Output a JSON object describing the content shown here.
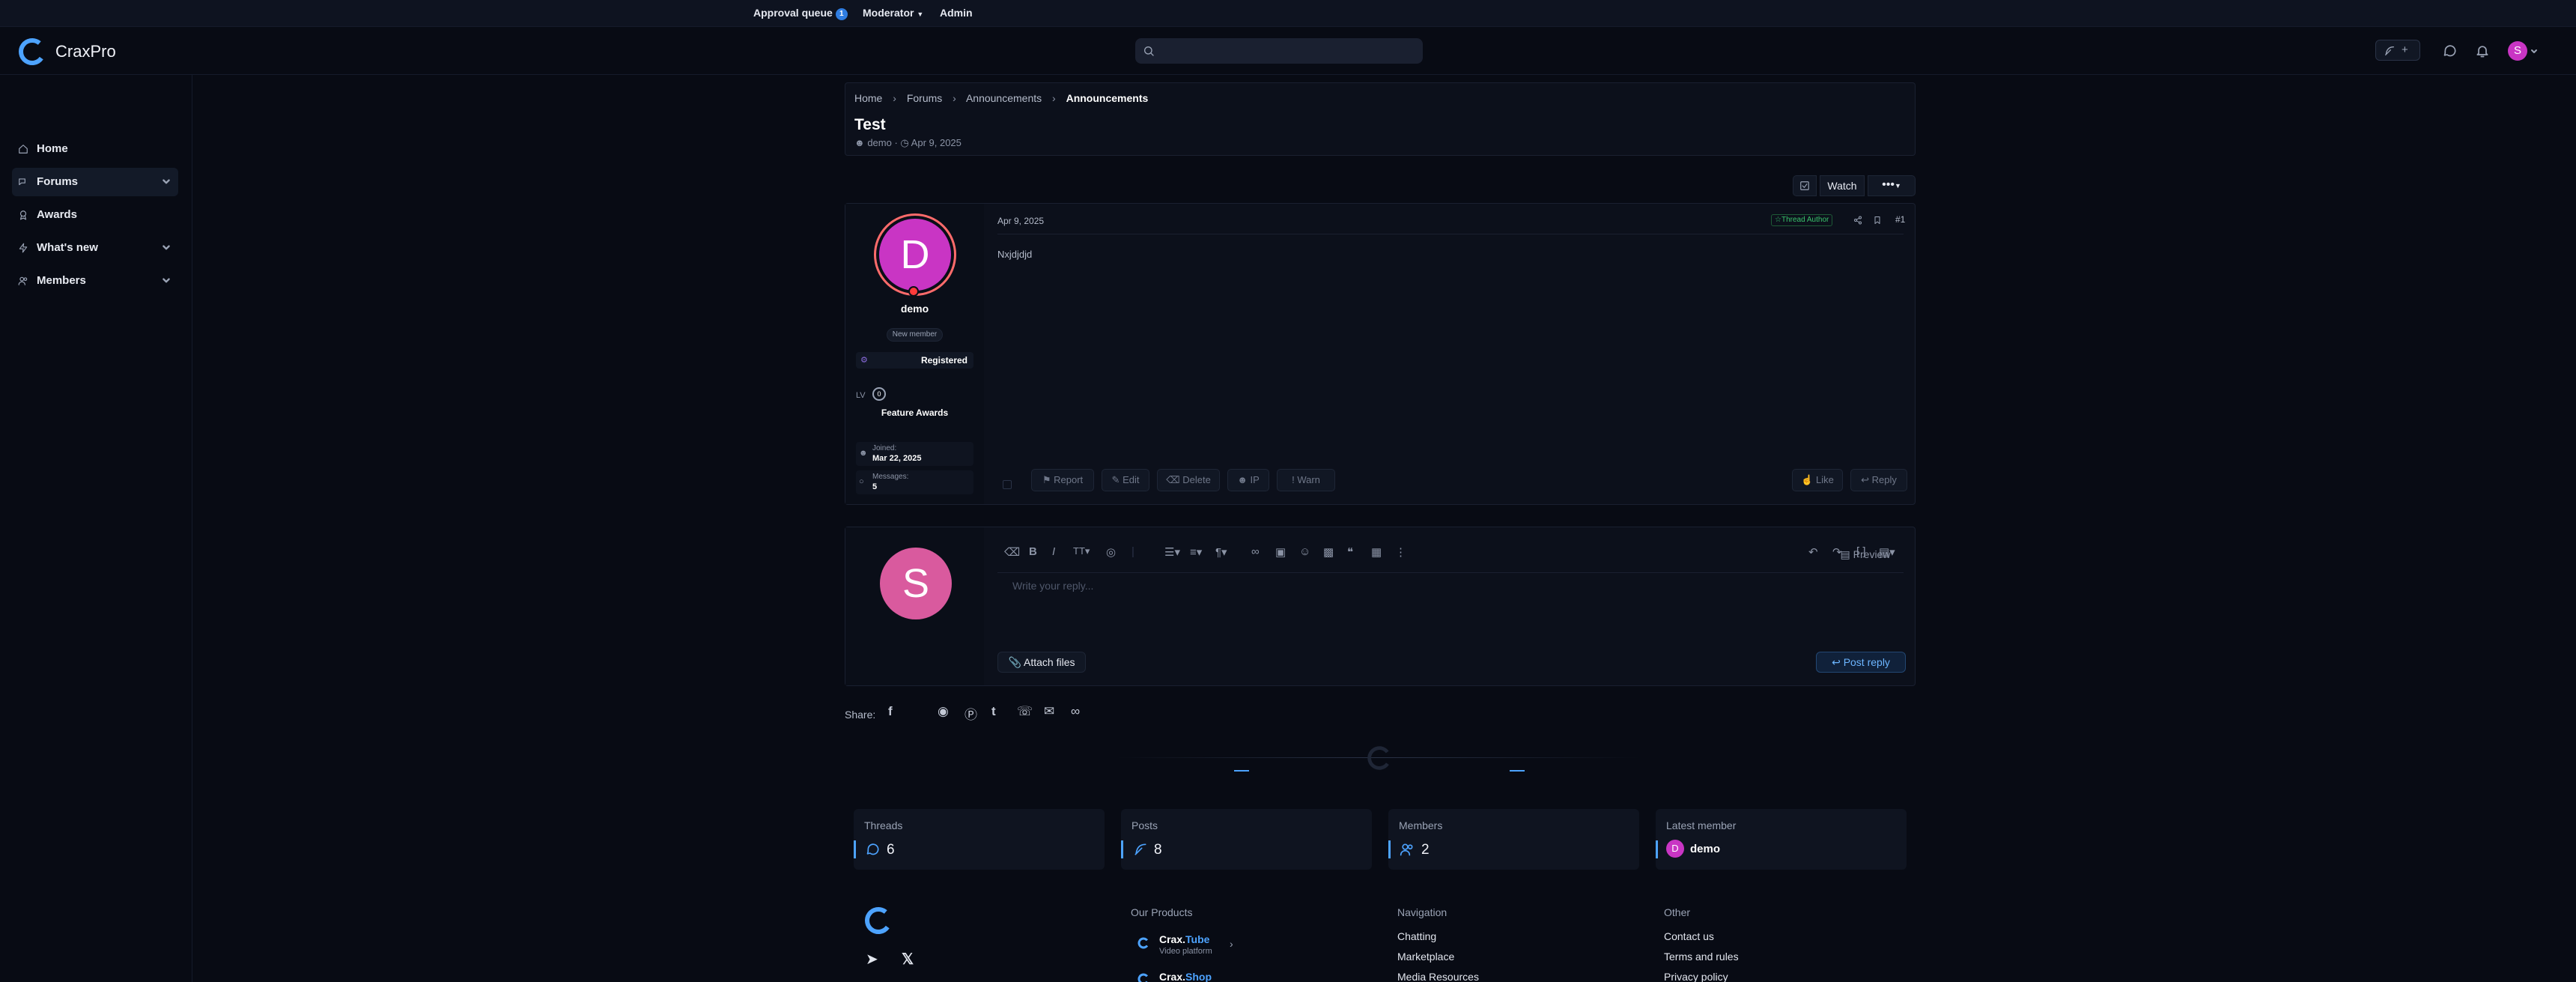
{
  "adminbar": {
    "approval_queue": "Approval queue",
    "approval_count": "1",
    "moderator": "Moderator",
    "admin": "Admin"
  },
  "header": {
    "logo_text": "CraxPro",
    "avatar_letter": "S"
  },
  "sidebar": {
    "items": [
      {
        "label": "Home"
      },
      {
        "label": "Forums"
      },
      {
        "label": "Awards"
      },
      {
        "label": "What's new"
      },
      {
        "label": "Members"
      }
    ]
  },
  "breadcrumb": [
    "Home",
    "Forums",
    "Announcements",
    "Announcements"
  ],
  "thread": {
    "title": "Test",
    "author": "demo",
    "date": "Apr 9, 2025"
  },
  "thread_actions": {
    "watch": "Watch"
  },
  "post": {
    "date": "Apr 9, 2025",
    "author_badge": "Thread Author",
    "number": "#1",
    "body": "Nxjdjdjd",
    "avatar_letter": "D",
    "username": "demo",
    "user_title": "New member",
    "group": "Registered",
    "lv_label": "LV",
    "lv_value": "0",
    "feature_awards": "Feature Awards",
    "joined_label": "Joined:",
    "joined_value": "Mar 22, 2025",
    "messages_label": "Messages:",
    "messages_value": "5",
    "actions": {
      "report": "Report",
      "edit": "Edit",
      "delete": "Delete",
      "ip": "IP",
      "warn": "Warn",
      "like": "Like",
      "reply": "Reply"
    }
  },
  "reply": {
    "avatar_letter": "S",
    "placeholder": "Write your reply...",
    "preview": "Preview",
    "attach": "Attach files",
    "post_reply": "Post reply"
  },
  "share": {
    "label": "Share:"
  },
  "stats": [
    {
      "label": "Threads",
      "value": "6"
    },
    {
      "label": "Posts",
      "value": "8"
    },
    {
      "label": "Members",
      "value": "2"
    },
    {
      "label": "Latest member",
      "value": "demo"
    }
  ],
  "footer": {
    "products_title": "Our Products",
    "products": [
      {
        "brand": "Crax.",
        "accent": "Tube",
        "sub": "Video platform"
      },
      {
        "brand": "Crax.",
        "accent": "Shop",
        "sub": ""
      }
    ],
    "nav_title": "Navigation",
    "nav": [
      "Chatting",
      "Marketplace",
      "Media Resources"
    ],
    "other_title": "Other",
    "other": [
      "Contact us",
      "Terms and rules",
      "Privacy policy"
    ]
  },
  "colors": {
    "accent": "#4da3ff",
    "avatar_pink": "#c935c4",
    "green": "#39c46b",
    "background": "#080b14"
  }
}
